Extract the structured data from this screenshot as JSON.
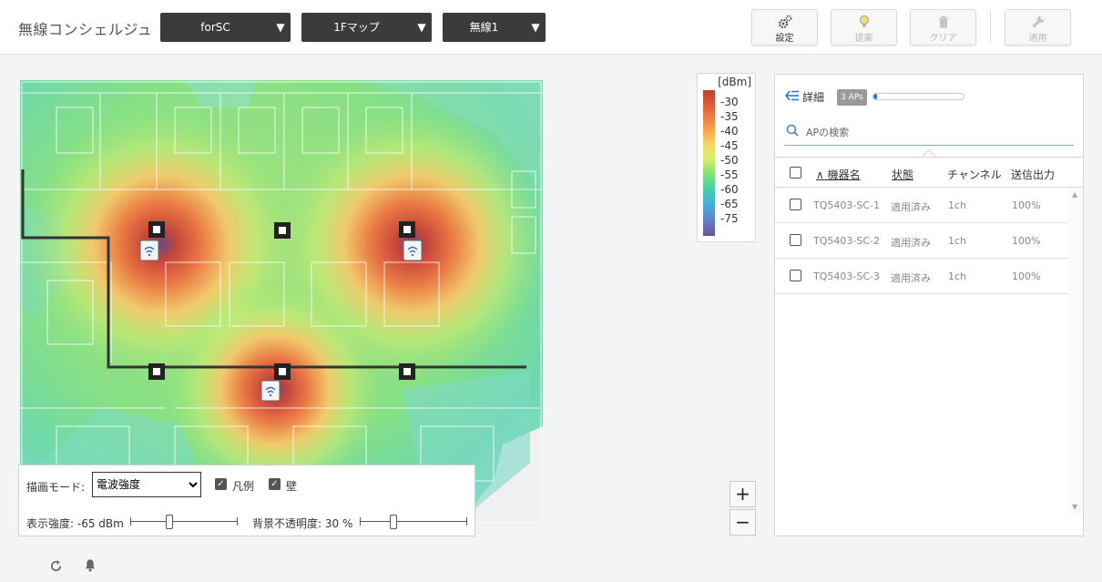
{
  "header": {
    "app_title": "無線コンシェルジュ",
    "dropdowns": [
      {
        "label": "forSC"
      },
      {
        "label": "1Fマップ"
      },
      {
        "label": "無線1"
      }
    ],
    "buttons": [
      {
        "label": "設定",
        "icon": "gear-icon",
        "enabled": true
      },
      {
        "label": "提案",
        "icon": "lightbulb-icon",
        "enabled": false
      },
      {
        "label": "クリア",
        "icon": "trash-icon",
        "enabled": false
      },
      {
        "label": "適用",
        "icon": "wrench-icon",
        "enabled": false
      }
    ]
  },
  "legend": {
    "unit": "[dBm]",
    "ticks": [
      "-30",
      "-35",
      "-40",
      "-45",
      "-50",
      "-55",
      "-60",
      "-65",
      "-75"
    ]
  },
  "zoom": {
    "plus": "+",
    "minus": "−"
  },
  "controls": {
    "mode_label": "描画モード:",
    "mode_selected": "電波強度",
    "legend_checkbox": {
      "label": "凡例",
      "checked": true
    },
    "wall_checkbox": {
      "label": "壁",
      "checked": true
    },
    "strength_label": "表示強度: -65 dBm",
    "strength_level": 0.35,
    "opacity_label": "背景不透明度: 30 %",
    "opacity_level": 0.3
  },
  "detail_panel": {
    "title": "詳細",
    "ap_badge": "3 APs",
    "progress": 0.04,
    "search_placeholder": "APの検索",
    "columns": [
      "∧ 機器名",
      "状態",
      "チャンネル",
      "送信出力"
    ],
    "rows": [
      {
        "name": "TQ5403-SC-1",
        "status": "適用済み",
        "channel": "1ch",
        "power": "100%"
      },
      {
        "name": "TQ5403-SC-2",
        "status": "適用済み",
        "channel": "1ch",
        "power": "100%"
      },
      {
        "name": "TQ5403-SC-3",
        "status": "適用済み",
        "channel": "1ch",
        "power": "100%"
      }
    ]
  },
  "footer": {
    "icons": [
      "refresh-icon",
      "bell-icon"
    ]
  },
  "colors": {
    "strong": "#c8463a",
    "medium": "#f2a24a",
    "weak": "#8fe47a",
    "weakest": "#5ec9d3",
    "accent": "#2a7ad1"
  }
}
